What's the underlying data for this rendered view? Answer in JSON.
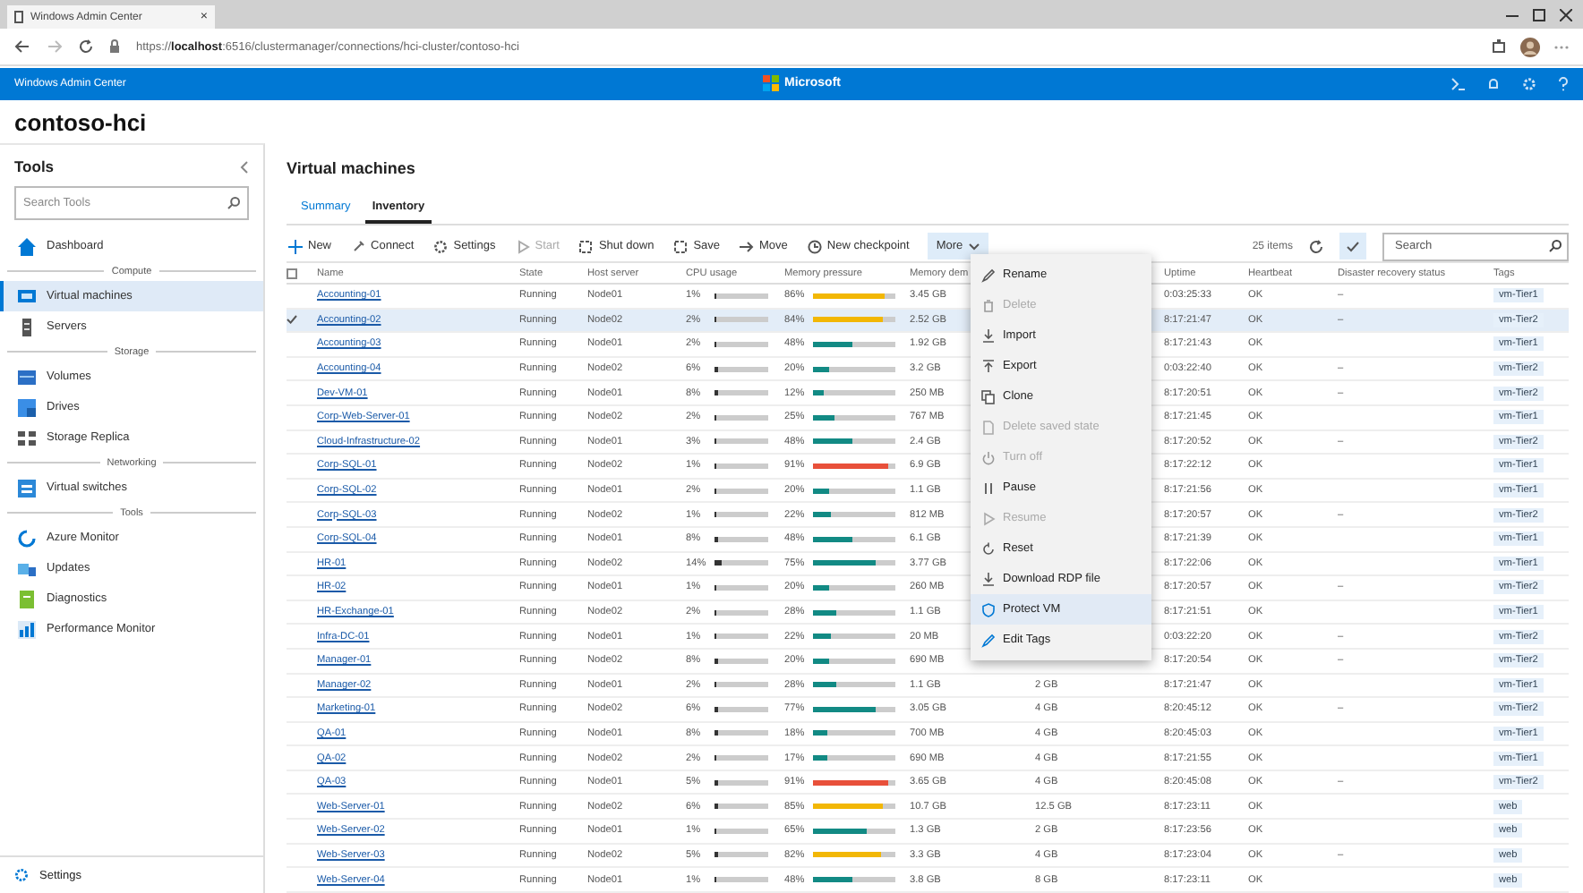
{
  "browser": {
    "tab_title": "Windows Admin Center",
    "tab_close": "×",
    "url": "https://**localhost**:6516/clustermanager/connections/hci-cluster/contoso-hci"
  },
  "app_bar": {
    "title": "Windows Admin Center",
    "brand": "Microsoft"
  },
  "cluster_name": "contoso-hci",
  "sidebar": {
    "title": "Tools",
    "search": {
      "placeholder": "Search Tools"
    },
    "items": [
      {
        "kind": "item",
        "label": "Dashboard",
        "selected": false
      },
      {
        "kind": "group",
        "label": "Compute"
      },
      {
        "kind": "item",
        "label": "Virtual machines",
        "selected": true
      },
      {
        "kind": "item",
        "label": "Servers",
        "selected": false
      },
      {
        "kind": "group",
        "label": "Storage"
      },
      {
        "kind": "item",
        "label": "Volumes",
        "selected": false
      },
      {
        "kind": "item",
        "label": "Drives",
        "selected": false
      },
      {
        "kind": "item",
        "label": "Storage Replica",
        "selected": false
      },
      {
        "kind": "group",
        "label": "Networking"
      },
      {
        "kind": "item",
        "label": "Virtual switches",
        "selected": false
      },
      {
        "kind": "group",
        "label": "Tools"
      },
      {
        "kind": "item",
        "label": "Azure Monitor",
        "selected": false
      },
      {
        "kind": "item",
        "label": "Updates",
        "selected": false
      },
      {
        "kind": "item",
        "label": "Diagnostics",
        "selected": false
      },
      {
        "kind": "item",
        "label": "Performance Monitor",
        "selected": false
      }
    ],
    "footer": "Settings"
  },
  "main": {
    "title": "Virtual machines",
    "tabs": [
      {
        "label": "Summary",
        "selected": false
      },
      {
        "label": "Inventory",
        "selected": true
      }
    ],
    "toolbar": [
      {
        "label": "New",
        "disabled": false
      },
      {
        "label": "Connect",
        "disabled": false
      },
      {
        "label": "Settings",
        "disabled": false
      },
      {
        "label": "Start",
        "disabled": true
      },
      {
        "label": "Shut down",
        "disabled": false
      },
      {
        "label": "Save",
        "disabled": false
      },
      {
        "label": "Move",
        "disabled": false
      },
      {
        "label": "New checkpoint",
        "disabled": false
      }
    ],
    "more": {
      "label": "More",
      "expanded": true
    },
    "item_count": "25 items",
    "search": {
      "placeholder": "Search"
    },
    "table": {
      "columns": [
        "Name",
        "State",
        "Host server",
        "CPU usage",
        "Memory pressure",
        "Memory dem",
        "Uptime",
        "Heartbeat",
        "Disaster recovery status",
        "Tags"
      ],
      "rows": [
        {
          "name": "Accounting-01",
          "state": "Running",
          "host": "Node01",
          "cpu": {
            "reading": "1%",
            "level": 0.01
          },
          "memory": {
            "reading": "86%",
            "level": 0.86
          },
          "demand": "3.45 GB",
          "uptime": "0:03:25:33",
          "heartbeat": "OK",
          "dr": "–",
          "tags": "vm-Tier1",
          "selected": false
        },
        {
          "name": "Accounting-02",
          "state": "Running",
          "host": "Node02",
          "cpu": {
            "reading": "2%",
            "level": 0.02
          },
          "memory": {
            "reading": "84%",
            "level": 0.84
          },
          "demand": "2.52 GB",
          "uptime": "8:17:21:47",
          "heartbeat": "OK",
          "dr": "–",
          "tags": "vm-Tier2",
          "selected": true
        },
        {
          "name": "Accounting-03",
          "state": "Running",
          "host": "Node01",
          "cpu": {
            "reading": "2%",
            "level": 0.02
          },
          "memory": {
            "reading": "48%",
            "level": 0.48
          },
          "demand": "1.92 GB",
          "uptime": "8:17:21:43",
          "heartbeat": "OK",
          "tags": "vm-Tier1",
          "selected": false
        },
        {
          "name": "Accounting-04",
          "state": "Running",
          "host": "Node02",
          "cpu": {
            "reading": "6%",
            "level": 0.06
          },
          "memory": {
            "reading": "20%",
            "level": 0.2
          },
          "demand": "3.2 GB",
          "uptime": "0:03:22:40",
          "heartbeat": "OK",
          "dr": "–",
          "tags": "vm-Tier2",
          "selected": false
        },
        {
          "name": "Dev-VM-01",
          "state": "Running",
          "host": "Node01",
          "cpu": {
            "reading": "8%",
            "level": 0.08
          },
          "memory": {
            "reading": "12%",
            "level": 0.12
          },
          "demand": "250 MB",
          "uptime": "8:17:20:51",
          "heartbeat": "OK",
          "dr": "–",
          "tags": "vm-Tier2",
          "selected": false
        },
        {
          "name": "Corp-Web-Server-01",
          "state": "Running",
          "host": "Node02",
          "cpu": {
            "reading": "2%",
            "level": 0.02
          },
          "memory": {
            "reading": "25%",
            "level": 0.25
          },
          "demand": "767 MB",
          "uptime": "8:17:21:45",
          "heartbeat": "OK",
          "tags": "vm-Tier1",
          "selected": false
        },
        {
          "name": "Cloud-Infrastructure-02",
          "state": "Running",
          "host": "Node01",
          "cpu": {
            "reading": "3%",
            "level": 0.03
          },
          "memory": {
            "reading": "48%",
            "level": 0.48
          },
          "demand": "2.4 GB",
          "uptime": "8:17:20:52",
          "heartbeat": "OK",
          "dr": "–",
          "tags": "vm-Tier2",
          "selected": false
        },
        {
          "name": "Corp-SQL-01",
          "state": "Running",
          "host": "Node02",
          "cpu": {
            "reading": "1%",
            "level": 0.01
          },
          "memory": {
            "reading": "91%",
            "level": 0.91
          },
          "demand": "6.9 GB",
          "uptime": "8:17:22:12",
          "heartbeat": "OK",
          "tags": "vm-Tier1",
          "selected": false
        },
        {
          "name": "Corp-SQL-02",
          "state": "Running",
          "host": "Node01",
          "cpu": {
            "reading": "2%",
            "level": 0.02
          },
          "memory": {
            "reading": "20%",
            "level": 0.2
          },
          "demand": "1.1 GB",
          "uptime": "8:17:21:56",
          "heartbeat": "OK",
          "tags": "vm-Tier1",
          "selected": false
        },
        {
          "name": "Corp-SQL-03",
          "state": "Running",
          "host": "Node02",
          "cpu": {
            "reading": "1%",
            "level": 0.01
          },
          "memory": {
            "reading": "22%",
            "level": 0.22
          },
          "demand": "812 MB",
          "uptime": "8:17:20:57",
          "heartbeat": "OK",
          "dr": "–",
          "tags": "vm-Tier2",
          "selected": false
        },
        {
          "name": "Corp-SQL-04",
          "state": "Running",
          "host": "Node01",
          "cpu": {
            "reading": "8%",
            "level": 0.08
          },
          "memory": {
            "reading": "48%",
            "level": 0.48
          },
          "demand": "6.1 GB",
          "uptime": "8:17:21:39",
          "heartbeat": "OK",
          "tags": "vm-Tier1",
          "selected": false
        },
        {
          "name": "HR-01",
          "state": "Running",
          "host": "Node02",
          "cpu": {
            "reading": "14%",
            "level": 0.14
          },
          "memory": {
            "reading": "75%",
            "level": 0.75
          },
          "demand": "3.77 GB",
          "uptime": "8:17:22:06",
          "heartbeat": "OK",
          "tags": "vm-Tier1",
          "selected": false
        },
        {
          "name": "HR-02",
          "state": "Running",
          "host": "Node01",
          "cpu": {
            "reading": "1%",
            "level": 0.01
          },
          "memory": {
            "reading": "20%",
            "level": 0.2
          },
          "demand": "260 MB",
          "uptime": "8:17:20:57",
          "heartbeat": "OK",
          "dr": "–",
          "tags": "vm-Tier2",
          "selected": false
        },
        {
          "name": "HR-Exchange-01",
          "state": "Running",
          "host": "Node02",
          "cpu": {
            "reading": "2%",
            "level": 0.02
          },
          "memory": {
            "reading": "28%",
            "level": 0.28
          },
          "demand": "1.1 GB",
          "uptime": "8:17:21:51",
          "heartbeat": "OK",
          "tags": "vm-Tier1",
          "selected": false
        },
        {
          "name": "Infra-DC-01",
          "state": "Running",
          "host": "Node01",
          "cpu": {
            "reading": "1%",
            "level": 0.01
          },
          "memory": {
            "reading": "22%",
            "level": 0.22
          },
          "demand": "20 MB",
          "uptime": "0:03:22:20",
          "heartbeat": "OK",
          "dr": "–",
          "tags": "vm-Tier2",
          "selected": false
        },
        {
          "name": "Manager-01",
          "state": "Running",
          "host": "Node02",
          "cpu": {
            "reading": "8%",
            "level": 0.08
          },
          "memory": {
            "reading": "20%",
            "level": 0.2
          },
          "demand": "690 MB",
          "uptime": "8:17:20:54",
          "heartbeat": "OK",
          "dr": "–",
          "tags": "vm-Tier2",
          "selected": false
        },
        {
          "name": "Manager-02",
          "state": "Running",
          "host": "Node01",
          "cpu": {
            "reading": "2%",
            "level": 0.02
          },
          "memory": {
            "reading": "28%",
            "level": 0.28
          },
          "demand": "1.1 GB",
          "assigned": "2 GB",
          "uptime": "8:17:21:47",
          "heartbeat": "OK",
          "tags": "vm-Tier1",
          "selected": false
        },
        {
          "name": "Marketing-01",
          "state": "Running",
          "host": "Node02",
          "cpu": {
            "reading": "6%",
            "level": 0.06
          },
          "memory": {
            "reading": "77%",
            "level": 0.77
          },
          "demand": "3.05 GB",
          "assigned": "4 GB",
          "uptime": "8:20:45:12",
          "heartbeat": "OK",
          "dr": "–",
          "tags": "vm-Tier2",
          "selected": false
        },
        {
          "name": "QA-01",
          "state": "Running",
          "host": "Node01",
          "cpu": {
            "reading": "8%",
            "level": 0.08
          },
          "memory": {
            "reading": "18%",
            "level": 0.18
          },
          "demand": "700 MB",
          "assigned": "4 GB",
          "uptime": "8:20:45:03",
          "heartbeat": "OK",
          "tags": "vm-Tier1",
          "selected": false
        },
        {
          "name": "QA-02",
          "state": "Running",
          "host": "Node02",
          "cpu": {
            "reading": "2%",
            "level": 0.02
          },
          "memory": {
            "reading": "17%",
            "level": 0.17
          },
          "demand": "690 MB",
          "assigned": "4 GB",
          "uptime": "8:17:21:55",
          "heartbeat": "OK",
          "tags": "vm-Tier1",
          "selected": false
        },
        {
          "name": "QA-03",
          "state": "Running",
          "host": "Node01",
          "cpu": {
            "reading": "5%",
            "level": 0.05
          },
          "memory": {
            "reading": "91%",
            "level": 0.91
          },
          "demand": "3.65 GB",
          "assigned": "4 GB",
          "uptime": "8:20:45:08",
          "heartbeat": "OK",
          "dr": "–",
          "tags": "vm-Tier2",
          "selected": false
        },
        {
          "name": "Web-Server-01",
          "state": "Running",
          "host": "Node02",
          "cpu": {
            "reading": "6%",
            "level": 0.06
          },
          "memory": {
            "reading": "85%",
            "level": 0.85
          },
          "demand": "10.7 GB",
          "assigned": "12.5 GB",
          "uptime": "8:17:23:11",
          "heartbeat": "OK",
          "tags": "web",
          "selected": false
        },
        {
          "name": "Web-Server-02",
          "state": "Running",
          "host": "Node01",
          "cpu": {
            "reading": "1%",
            "level": 0.01
          },
          "memory": {
            "reading": "65%",
            "level": 0.65
          },
          "demand": "1.3 GB",
          "assigned": "2 GB",
          "uptime": "8:17:23:56",
          "heartbeat": "OK",
          "tags": "web",
          "selected": false
        },
        {
          "name": "Web-Server-03",
          "state": "Running",
          "host": "Node02",
          "cpu": {
            "reading": "5%",
            "level": 0.05
          },
          "memory": {
            "reading": "82%",
            "level": 0.82
          },
          "demand": "3.3 GB",
          "assigned": "4 GB",
          "uptime": "8:17:23:04",
          "heartbeat": "OK",
          "dr": "–",
          "tags": "web",
          "selected": false
        },
        {
          "name": "Web-Server-04",
          "state": "Running",
          "host": "Node01",
          "cpu": {
            "reading": "1%",
            "level": 0.01
          },
          "memory": {
            "reading": "48%",
            "level": 0.48
          },
          "demand": "3.8 GB",
          "assigned": "8 GB",
          "uptime": "8:17:23:11",
          "heartbeat": "OK",
          "tags": "web",
          "selected": false
        }
      ]
    },
    "menu": [
      {
        "label": "Rename",
        "disabled": false,
        "highlighted": false
      },
      {
        "label": "Delete",
        "disabled": true,
        "highlighted": false
      },
      {
        "label": "Import",
        "disabled": false,
        "highlighted": false
      },
      {
        "label": "Export",
        "disabled": false,
        "highlighted": false
      },
      {
        "label": "Clone",
        "disabled": false,
        "highlighted": false
      },
      {
        "label": "Delete saved state",
        "disabled": true,
        "highlighted": false
      },
      {
        "label": "Turn off",
        "disabled": true,
        "highlighted": false
      },
      {
        "label": "Pause",
        "disabled": false,
        "highlighted": false
      },
      {
        "label": "Resume",
        "disabled": true,
        "highlighted": false
      },
      {
        "label": "Reset",
        "disabled": false,
        "highlighted": false
      },
      {
        "label": "Download RDP file",
        "disabled": false,
        "highlighted": false
      },
      {
        "label": "Protect VM",
        "disabled": false,
        "highlighted": true
      },
      {
        "label": "Edit Tags",
        "disabled": false,
        "highlighted": false
      }
    ]
  }
}
